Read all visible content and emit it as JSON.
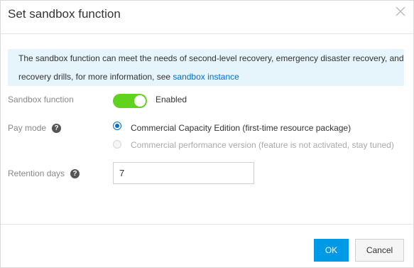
{
  "dialog": {
    "title": "Set sandbox function",
    "info_text": "The sandbox function can meet the needs of second-level recovery, emergency disaster recovery, and recovery drills, for more information, see ",
    "info_link": "sandbox instance"
  },
  "form": {
    "sandbox_label": "Sandbox function",
    "sandbox_state": "Enabled",
    "sandbox_enabled": true,
    "pay_mode_label": "Pay mode",
    "pay_options": [
      {
        "label": "Commercial Capacity Edition (first-time resource package)",
        "selected": true,
        "disabled": false
      },
      {
        "label": "Commercial performance version (feature is not activated, stay tuned)",
        "selected": false,
        "disabled": true
      }
    ],
    "retention_label": "Retention days",
    "retention_value": "7"
  },
  "footer": {
    "ok_label": "OK",
    "cancel_label": "Cancel"
  },
  "colors": {
    "primary": "#0099e5",
    "link": "#0070cc",
    "switch_on": "#5fd31e",
    "info_bg": "#e6f4fb"
  }
}
